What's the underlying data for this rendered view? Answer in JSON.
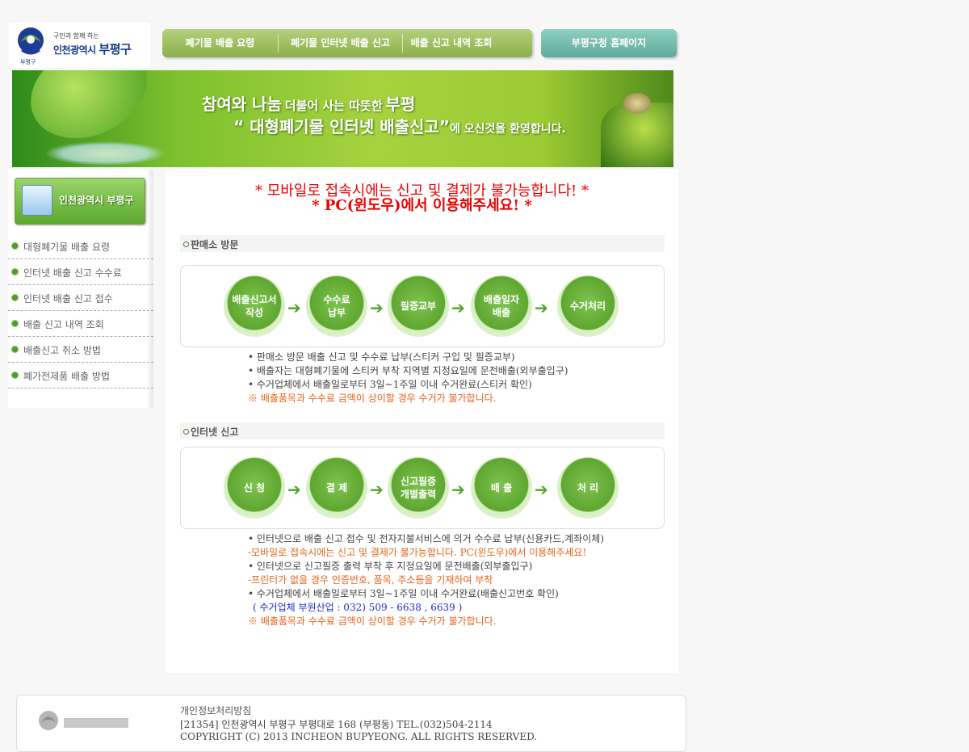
{
  "logo": {
    "slogan": "구민과 함께 하는",
    "city": "인천광역시",
    "gu": "부평구",
    "emblem_caption": "부평구"
  },
  "topnav": {
    "items": [
      "폐기물 배출 요령",
      "폐기물 인터넷 배출 신고",
      "배출 신고 내역 조회"
    ],
    "home": "부평구청 홈페이지"
  },
  "banner": {
    "line1_a": "참여와 나눔",
    "line1_b": "더불어 사는 따뜻한",
    "line1_c": "부평",
    "line2_a": "“ 대형폐기물 인터넷 배출신고”",
    "line2_b": "에 오신것을 환영합니다."
  },
  "sidebar": {
    "badge": "인천광역시 부평구",
    "items": [
      "대형폐기물 배출 요령",
      "인터넷 배출 신고 수수료",
      "인터넷 배출 신고 접수",
      "배출 신고 내역 조회",
      "배출신고 취소 방법",
      "폐가전제품 배출 방법"
    ]
  },
  "main": {
    "warning1": "* 모바일로 접속시에는 신고 및 결제가 불가능합니다! *",
    "warning2": "* PC(윈도우)에서 이용해주세요! *",
    "section1": {
      "title": "판매소 방문",
      "steps": [
        "배출신고서\n작성",
        "수수료\n납부",
        "필증교부",
        "배출일자\n배출",
        "수거처리"
      ],
      "notes": [
        "• 판매소 방문 배출 신고 및 수수료 납부(스티커 구입 및 필증교부)",
        "• 배출자는 대형폐기물에 스티커 부착 지역별 지정요일에 문전배출(외부출입구)",
        "• 수거업체에서 배출일로부터 3일~1주일 이내 수거완료(스티커 확인)",
        "※ 배출품목과 수수료 금액이 상이할 경우 수거가 불가합니다."
      ]
    },
    "section2": {
      "title": "인터넷 신고",
      "steps": [
        "신 청",
        "결 제",
        "신고필증\n개별출력",
        "배 출",
        "처 리"
      ],
      "notes": [
        "• 인터넷으로 배출 신고 접수 및 전자지불서비스에 의거 수수료 납부(신용카드,계좌이체)",
        "-모바일로 접속시에는 신고 및 결제가 불가능합니다. PC(윈도우)에서 이용해주세요!",
        "• 인터넷으로 신고필증 출력 부착 후 지정요일에 문전배출(외부출입구)",
        "-프린터가 없을 경우 인증번호, 품목, 주소등을 기재하여 부착",
        "• 수거업체에서 배출일로부터 3일~1주일 이내 수거완료(배출신고번호 확인)",
        "( 수거업체 부원산업 : 032) 509 - 6638 , 6639 )",
        "※ 배출품목과 수수료 금액이 상이할 경우 수거가 불가합니다."
      ]
    }
  },
  "footer": {
    "privacy": "개인정보처리방침",
    "address": "[21354] 인천광역시 부평구 부평대로 168 (부평동) TEL.(032)504-2114",
    "copyright": "COPYRIGHT (C) 2013 INCHEON BUPYEONG. ALL RIGHTS RESERVED."
  },
  "colors": {
    "accent_green": "#5ea72f",
    "warning_red": "#ee0000",
    "note_orange": "#e8641a",
    "note_blue": "#1a2fd0"
  }
}
